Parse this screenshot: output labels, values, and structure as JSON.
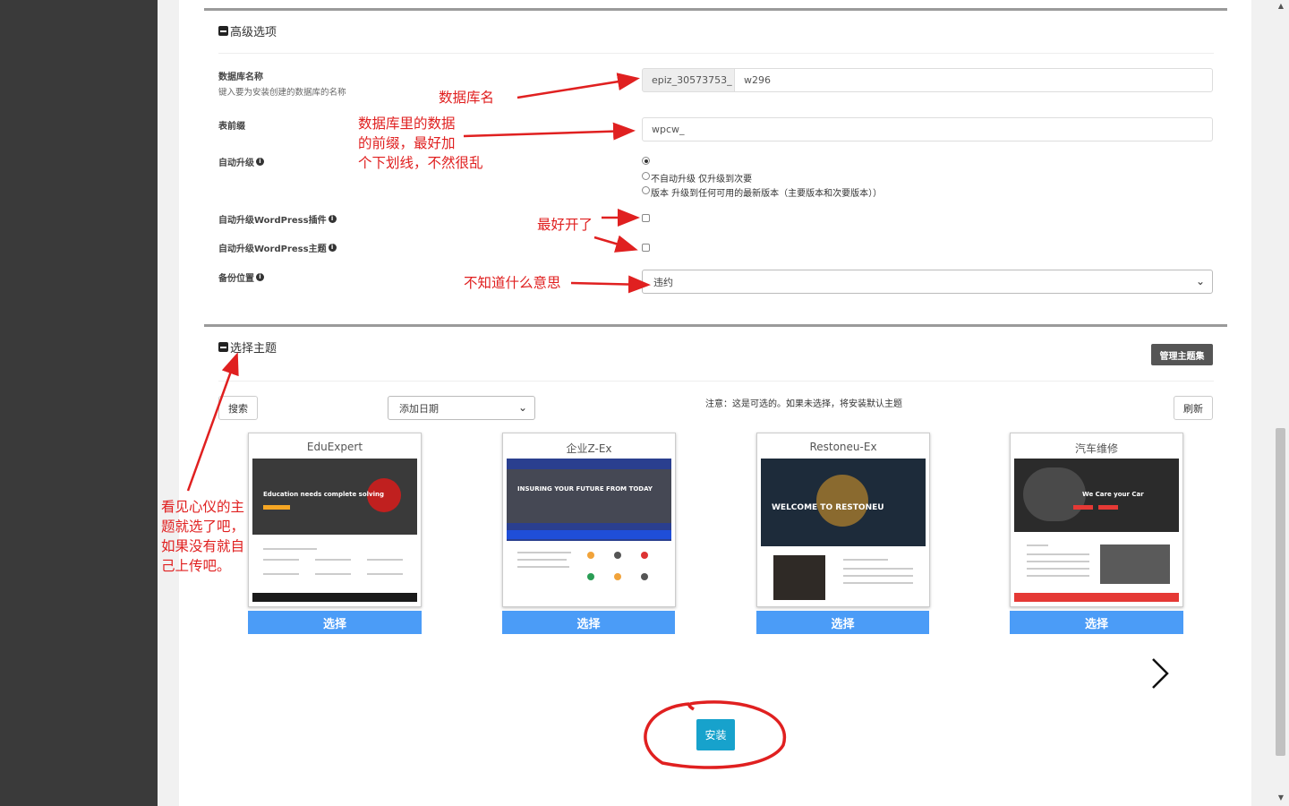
{
  "advanced": {
    "title": "高级选项",
    "db_name_label": "数据库名称",
    "db_name_hint": "键入要为安装创建的数据库的名称",
    "db_prefix_value": "epiz_30573753_",
    "db_name_value": "w296",
    "table_prefix_label": "表前缀",
    "table_prefix_value": "wpcw_",
    "auto_upgrade_label": "自动升级",
    "auto_upgrade_options": [
      "",
      "不自动升级 仅升级到次要",
      "版本 升级到任何可用的最新版本（主要版本和次要版本））"
    ],
    "auto_upgrade_plugins_label": "自动升级WordPress插件",
    "auto_upgrade_themes_label": "自动升级WordPress主题",
    "backup_location_label": "备份位置",
    "backup_location_value": "违约"
  },
  "themes": {
    "title": "选择主题",
    "manage_button": "管理主题集",
    "search_button": "搜索",
    "sort_select": "添加日期",
    "note": "注意：这是可选的。如果未选择，将安装默认主题",
    "refresh_button": "刷新",
    "select_label": "选择",
    "cards": [
      {
        "name": "EduExpert",
        "hero_text": "Education needs complete solving",
        "color": "#3a3a3a"
      },
      {
        "name": "企业Z-Ex",
        "hero_text": "INSURING YOUR FUTURE FROM TODAY",
        "color": "#2a3f8f"
      },
      {
        "name": "Restoneu-Ex",
        "hero_text": "WELCOME TO RESTONEU",
        "color": "#1d2b3a"
      },
      {
        "name": "汽车维修",
        "hero_text": "We Care your Car",
        "color": "#2b2b2b"
      }
    ]
  },
  "install_button": "安装",
  "annotations": {
    "db_name": "数据库名",
    "table_prefix_1": "数据库里的数据",
    "table_prefix_2": "的前缀，最好加",
    "table_prefix_3": "个下划线，不然很乱",
    "best_on": "最好开了",
    "unknown": "不知道什么意思",
    "theme_1": "看见心仪的主",
    "theme_2": "题就选了吧，",
    "theme_3": "如果没有就自",
    "theme_4": "己上传吧。"
  },
  "colors": {
    "annotation_red": "#e02020",
    "select_blue": "#4b9cf7",
    "install_teal": "#17a2cc"
  }
}
